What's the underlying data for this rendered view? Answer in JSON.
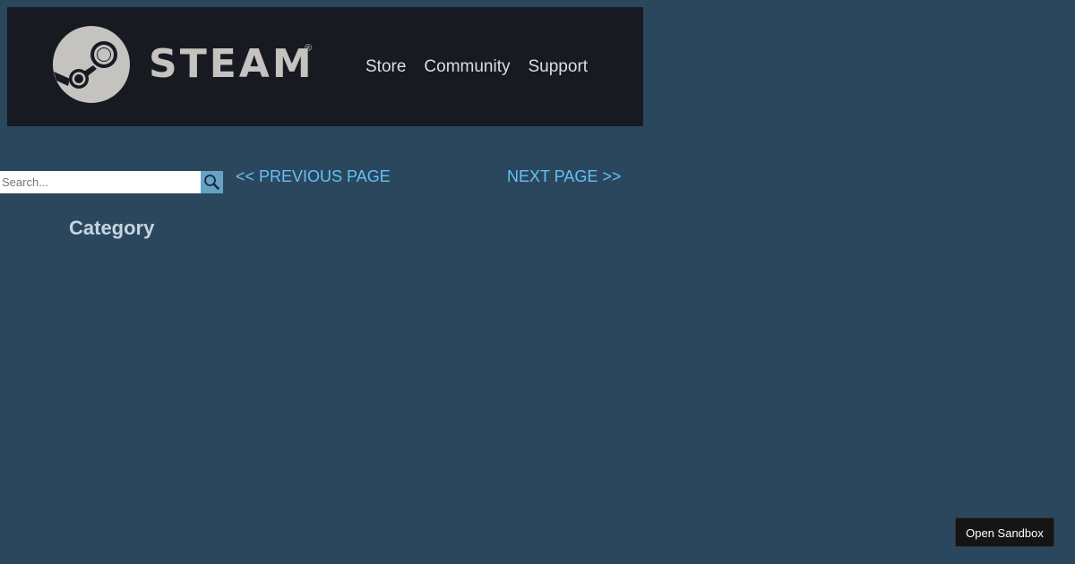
{
  "header": {
    "logo_text": "STEAM",
    "logo_registered": "®",
    "nav_items": [
      "Store",
      "Community",
      "Support"
    ]
  },
  "search": {
    "placeholder": "Search...",
    "value": ""
  },
  "pagination": {
    "previous_label": "<< PREVIOUS PAGE",
    "next_label": "NEXT PAGE >>"
  },
  "main": {
    "heading": "Category"
  },
  "sandbox": {
    "label": "Open Sandbox"
  },
  "colors": {
    "background": "#2a475e",
    "header_background": "#171a21",
    "link": "#66c0f4",
    "nav_text": "#dcdedf",
    "logo": "#c5c3c0",
    "heading": "#c6d4df",
    "search_button": "#67a2c5"
  },
  "icons": {
    "logo": "steam-logo-icon",
    "search": "magnifier-icon"
  }
}
